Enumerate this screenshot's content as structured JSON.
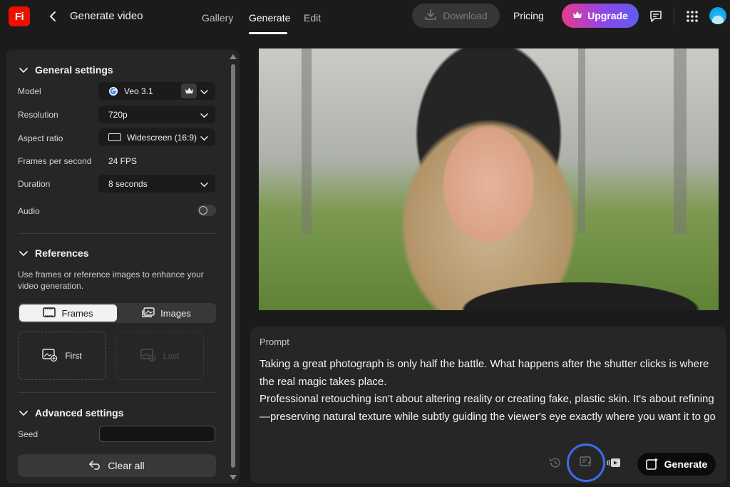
{
  "app": {
    "logo_text": "Fi",
    "title": "Generate video"
  },
  "nav": {
    "tabs": [
      "Gallery",
      "Generate",
      "Edit"
    ],
    "active": "Generate"
  },
  "toolbar": {
    "download_label": "Download",
    "pricing_label": "Pricing",
    "upgrade_label": "Upgrade"
  },
  "general": {
    "title": "General settings",
    "model": {
      "label": "Model",
      "value": "Veo 3.1"
    },
    "resolution": {
      "label": "Resolution",
      "value": "720p"
    },
    "aspect": {
      "label": "Aspect ratio",
      "value": "Widescreen (16:9)"
    },
    "fps": {
      "label": "Frames per second",
      "value": "24 FPS"
    },
    "duration": {
      "label": "Duration",
      "value": "8 seconds"
    },
    "audio": {
      "label": "Audio",
      "enabled": false
    }
  },
  "references": {
    "title": "References",
    "description": "Use frames or reference images to enhance your video generation.",
    "tabs": [
      "Frames",
      "Images"
    ],
    "active_tab": "Frames",
    "first_label": "First",
    "last_label": "Last"
  },
  "advanced": {
    "title": "Advanced settings",
    "seed_label": "Seed",
    "seed_value": ""
  },
  "clear_label": "Clear all",
  "prompt": {
    "label": "Prompt",
    "line1": "Taking a great photograph is only half the battle. What happens after the shutter clicks is where the real magic takes place.",
    "line2": "Professional retouching isn't about altering reality or creating fake, plastic skin. It's about refining—preserving natural texture while subtly guiding the viewer's eye exactly where you want it to go"
  },
  "generate_label": "Generate",
  "colors": {
    "accent_ring": "#3c6cf0",
    "logo_red": "#eb1000",
    "upgrade_from": "#e63c8c",
    "upgrade_to": "#5c5ef0"
  }
}
